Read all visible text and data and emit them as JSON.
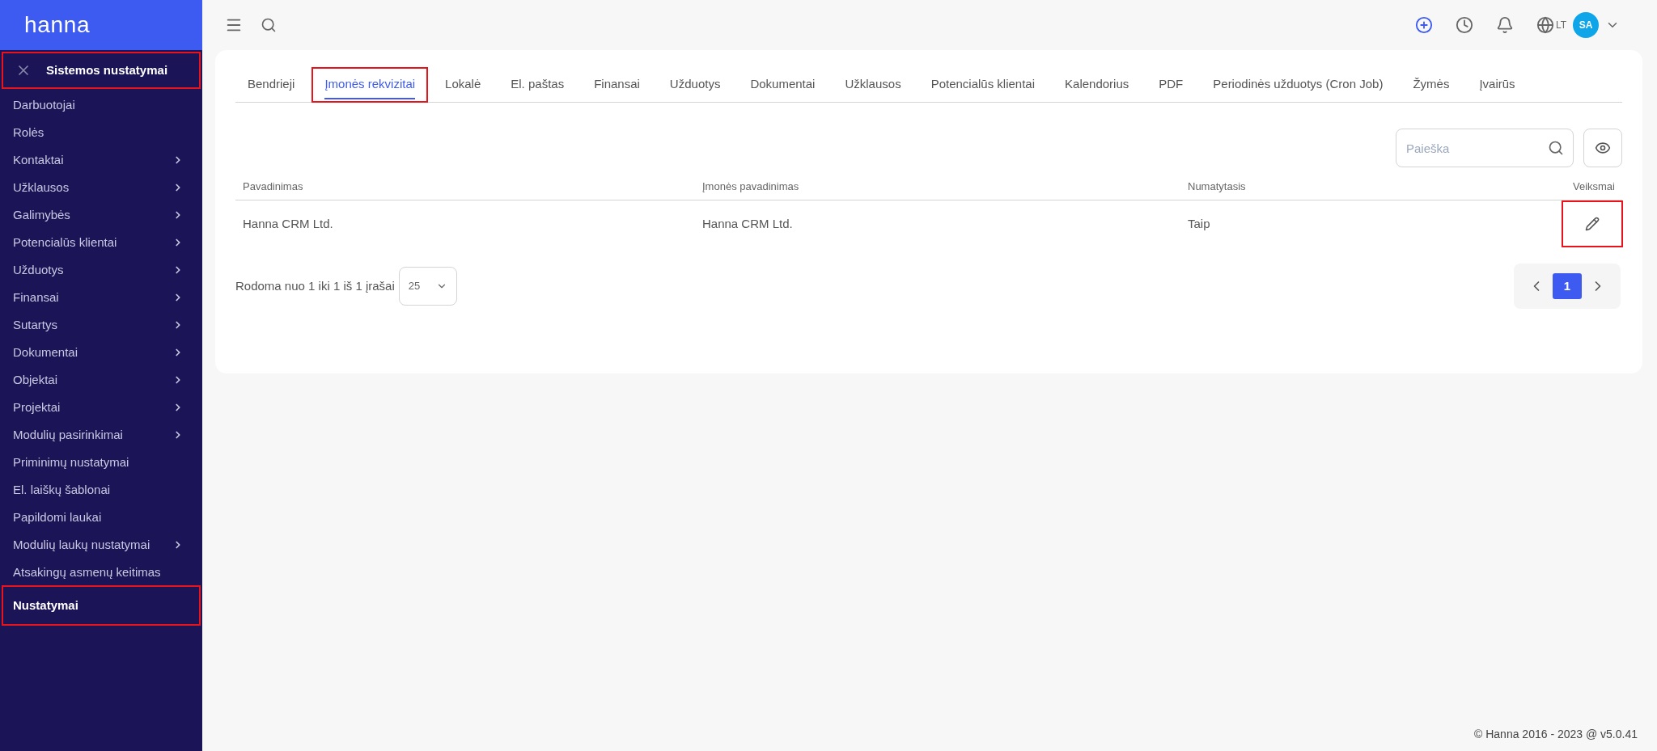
{
  "logo": "hanna",
  "sidebar": {
    "header": {
      "title": "Sistemos nustatymai",
      "highlighted": true
    },
    "items": [
      {
        "label": "Darbuotojai",
        "has_children": false,
        "selected": false,
        "highlighted": false
      },
      {
        "label": "Rolės",
        "has_children": false,
        "selected": false,
        "highlighted": false
      },
      {
        "label": "Kontaktai",
        "has_children": true,
        "selected": false,
        "highlighted": false
      },
      {
        "label": "Užklausos",
        "has_children": true,
        "selected": false,
        "highlighted": false
      },
      {
        "label": "Galimybės",
        "has_children": true,
        "selected": false,
        "highlighted": false
      },
      {
        "label": "Potencialūs klientai",
        "has_children": true,
        "selected": false,
        "highlighted": false
      },
      {
        "label": "Užduotys",
        "has_children": true,
        "selected": false,
        "highlighted": false
      },
      {
        "label": "Finansai",
        "has_children": true,
        "selected": false,
        "highlighted": false
      },
      {
        "label": "Sutartys",
        "has_children": true,
        "selected": false,
        "highlighted": false
      },
      {
        "label": "Dokumentai",
        "has_children": true,
        "selected": false,
        "highlighted": false
      },
      {
        "label": "Objektai",
        "has_children": true,
        "selected": false,
        "highlighted": false
      },
      {
        "label": "Projektai",
        "has_children": true,
        "selected": false,
        "highlighted": false
      },
      {
        "label": "Modulių pasirinkimai",
        "has_children": true,
        "selected": false,
        "highlighted": false
      },
      {
        "label": "Priminimų nustatymai",
        "has_children": false,
        "selected": false,
        "highlighted": false
      },
      {
        "label": "El. laiškų šablonai",
        "has_children": false,
        "selected": false,
        "highlighted": false
      },
      {
        "label": "Papildomi laukai",
        "has_children": false,
        "selected": false,
        "highlighted": false
      },
      {
        "label": "Modulių laukų nustatymai",
        "has_children": true,
        "selected": false,
        "highlighted": false
      },
      {
        "label": "Atsakingų asmenų keitimas",
        "has_children": false,
        "selected": false,
        "highlighted": false
      },
      {
        "label": "Nustatymai",
        "has_children": false,
        "selected": true,
        "highlighted": true
      }
    ]
  },
  "topbar": {
    "language": "LT",
    "avatar": "SA"
  },
  "tabs": [
    {
      "label": "Bendrieji",
      "selected": false,
      "highlighted": false
    },
    {
      "label": "Įmonės rekvizitai",
      "selected": true,
      "highlighted": true
    },
    {
      "label": "Lokalė",
      "selected": false,
      "highlighted": false
    },
    {
      "label": "El. paštas",
      "selected": false,
      "highlighted": false
    },
    {
      "label": "Finansai",
      "selected": false,
      "highlighted": false
    },
    {
      "label": "Užduotys",
      "selected": false,
      "highlighted": false
    },
    {
      "label": "Dokumentai",
      "selected": false,
      "highlighted": false
    },
    {
      "label": "Užklausos",
      "selected": false,
      "highlighted": false
    },
    {
      "label": "Potencialūs klientai",
      "selected": false,
      "highlighted": false
    },
    {
      "label": "Kalendorius",
      "selected": false,
      "highlighted": false
    },
    {
      "label": "PDF",
      "selected": false,
      "highlighted": false
    },
    {
      "label": "Periodinės užduotys (Cron Job)",
      "selected": false,
      "highlighted": false
    },
    {
      "label": "Žymės",
      "selected": false,
      "highlighted": false
    },
    {
      "label": "Įvairūs",
      "selected": false,
      "highlighted": false
    }
  ],
  "search": {
    "placeholder": "Paieška"
  },
  "table": {
    "columns": [
      "Pavadinimas",
      "Įmonės pavadinimas",
      "Numatytasis",
      "Veiksmai"
    ],
    "rows": [
      {
        "cells": [
          "Hanna CRM Ltd.",
          "Hanna CRM Ltd.",
          "Taip"
        ],
        "edit_highlighted": true
      }
    ]
  },
  "pagination": {
    "summary": "Rodoma nuo 1 iki 1 iš 1 įrašai",
    "page_size": "25",
    "pages": [
      {
        "label": "1",
        "selected": true
      }
    ]
  },
  "footer": "© Hanna 2016 - 2023 @ v5.0.41"
}
